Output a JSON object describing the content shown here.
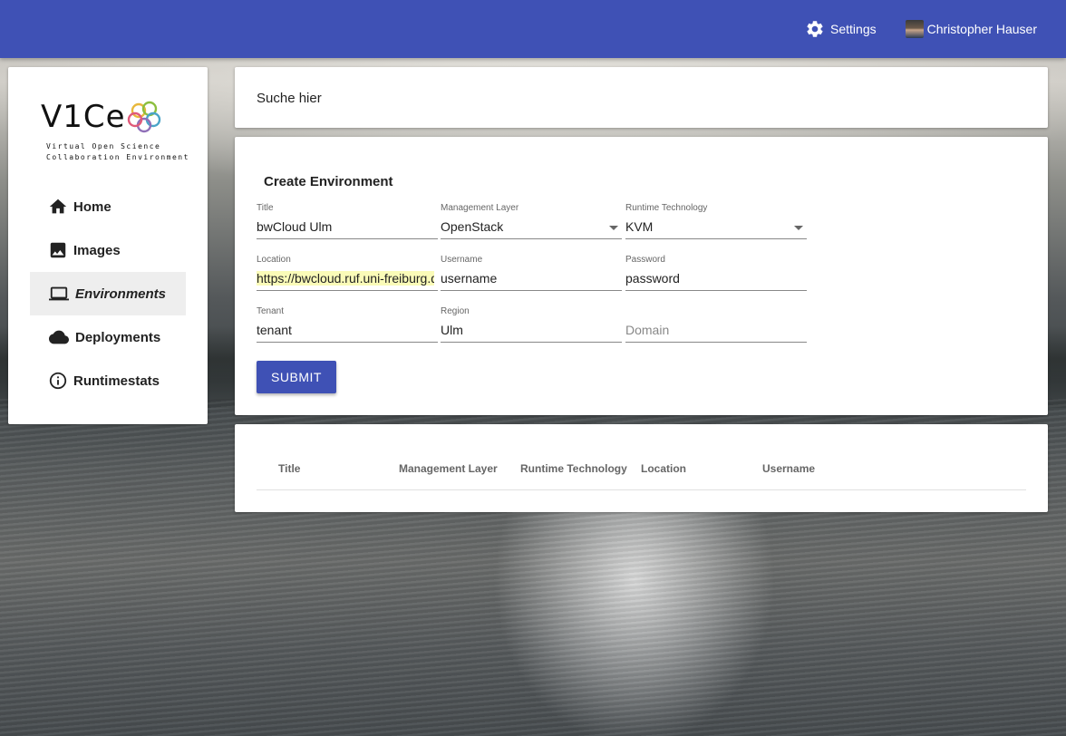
{
  "topbar": {
    "settings_label": "Settings",
    "user_name": "Christopher Hauser",
    "accent_color": "#3f51b5"
  },
  "logo": {
    "mark": "V1Ce",
    "subtitle_line1": "Virtual Open Science",
    "subtitle_line2": "Collaboration Environment"
  },
  "sidebar": {
    "items": [
      {
        "label": "Home",
        "icon": "home-icon",
        "active": false
      },
      {
        "label": "Images",
        "icon": "image-icon",
        "active": false
      },
      {
        "label": "Environments",
        "icon": "laptop-icon",
        "active": true
      },
      {
        "label": "Deployments",
        "icon": "cloud-icon",
        "active": false
      },
      {
        "label": "Runtimestats",
        "icon": "info-icon",
        "active": false
      }
    ]
  },
  "search": {
    "placeholder": "Suche hier"
  },
  "form": {
    "title": "Create Environment",
    "fields": {
      "title": {
        "label": "Title",
        "value": "bwCloud Ulm"
      },
      "management_layer": {
        "label": "Management Layer",
        "value": "OpenStack"
      },
      "runtime_technology": {
        "label": "Runtime Technology",
        "value": "KVM"
      },
      "location": {
        "label": "Location",
        "value": "https://bwcloud.ruf.uni-freiburg.de"
      },
      "username": {
        "label": "Username",
        "value": "username"
      },
      "password": {
        "label": "Password",
        "value": "password"
      },
      "tenant": {
        "label": "Tenant",
        "value": "tenant"
      },
      "region": {
        "label": "Region",
        "value": "Ulm"
      },
      "domain": {
        "label": "",
        "placeholder": "Domain",
        "value": ""
      }
    },
    "submit_label": "SUBMIT"
  },
  "table": {
    "columns": [
      "Title",
      "Management Layer",
      "Runtime Technology",
      "Location",
      "Username"
    ],
    "rows": []
  }
}
